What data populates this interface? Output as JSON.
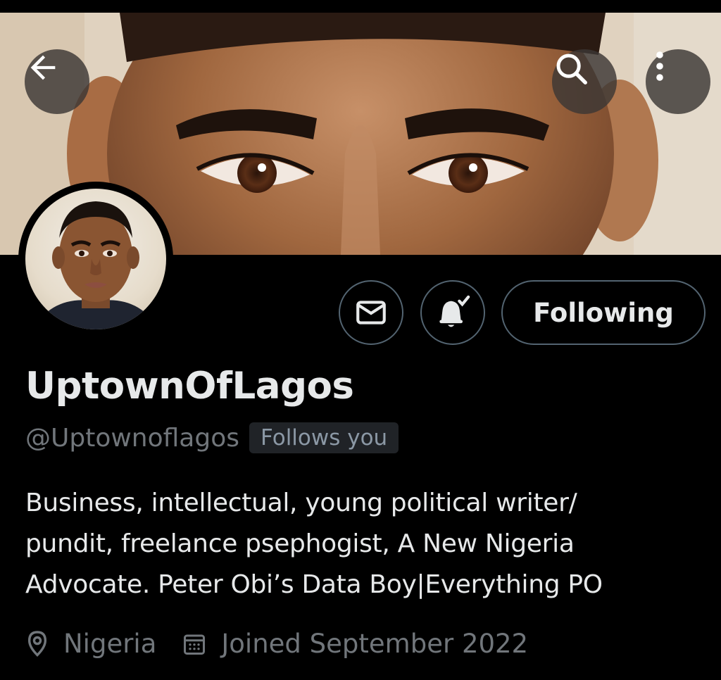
{
  "header": {
    "back_icon": "arrow-left-icon",
    "search_icon": "search-icon",
    "more_icon": "more-vertical-icon"
  },
  "profile": {
    "display_name": "UptownOfLagos",
    "handle": "@Uptownoflagos",
    "follows_you_badge": "Follows you",
    "bio_lines": [
      "Business, intellectual, young political writer/",
      "pundit, freelance psephogist, A New Nigeria",
      "Advocate. Peter Obi’s Data Boy|Everything PO"
    ],
    "location": "Nigeria",
    "joined": "Joined September 2022"
  },
  "actions": {
    "message_icon": "envelope-icon",
    "notifications_icon": "bell-check-icon",
    "follow_label": "Following"
  },
  "colors": {
    "background": "#000000",
    "text_primary": "#e7e9ea",
    "text_secondary": "#71767b",
    "border": "#536471",
    "badge_bg": "#202327"
  }
}
